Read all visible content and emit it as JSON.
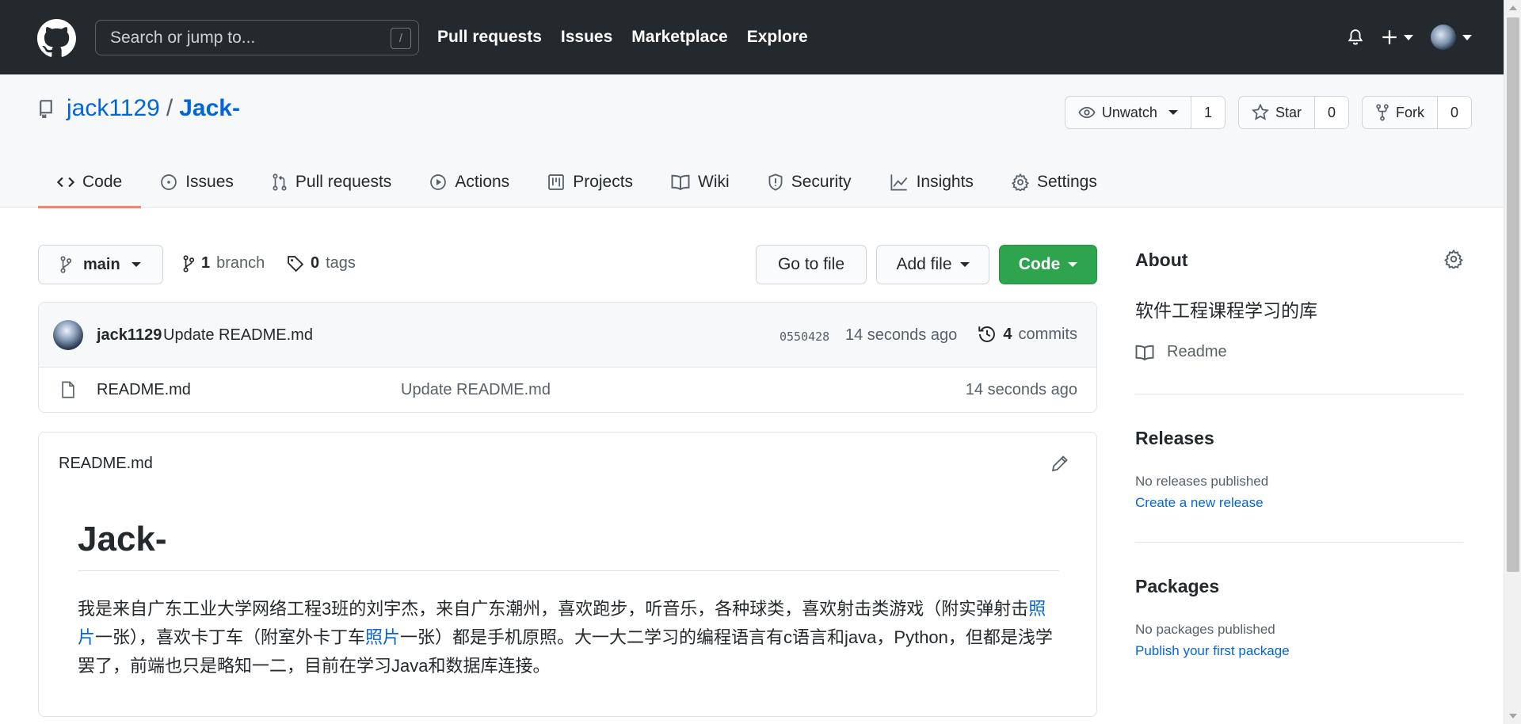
{
  "header": {
    "search_placeholder": "Search or jump to...",
    "search_shortcut": "/",
    "nav": [
      "Pull requests",
      "Issues",
      "Marketplace",
      "Explore"
    ]
  },
  "repo": {
    "owner": "jack1129",
    "separator": "/",
    "name": "Jack-",
    "watch_label": "Unwatch",
    "watch_count": "1",
    "star_label": "Star",
    "star_count": "0",
    "fork_label": "Fork",
    "fork_count": "0"
  },
  "tabs": [
    {
      "label": "Code",
      "icon": "code-icon",
      "active": true
    },
    {
      "label": "Issues",
      "icon": "issue-icon"
    },
    {
      "label": "Pull requests",
      "icon": "pull-request-icon"
    },
    {
      "label": "Actions",
      "icon": "play-icon"
    },
    {
      "label": "Projects",
      "icon": "project-icon"
    },
    {
      "label": "Wiki",
      "icon": "book-icon"
    },
    {
      "label": "Security",
      "icon": "shield-icon"
    },
    {
      "label": "Insights",
      "icon": "graph-icon"
    },
    {
      "label": "Settings",
      "icon": "gear-icon"
    }
  ],
  "branchbar": {
    "branch": "main",
    "branch_count": "1",
    "branch_label": "branch",
    "tag_count": "0",
    "tag_label": "tags",
    "go_to_file": "Go to file",
    "add_file": "Add file",
    "code": "Code"
  },
  "commit": {
    "author": "jack1129",
    "message": "Update README.md",
    "sha": "0550428",
    "time": "14 seconds ago",
    "count": "4",
    "count_label": "commits"
  },
  "files": [
    {
      "name": "README.md",
      "message": "Update README.md",
      "time": "14 seconds ago"
    }
  ],
  "readme": {
    "filename": "README.md",
    "title": "Jack-",
    "p_part1": "我是来自广东工业大学网络工程3班的刘宇杰，来自广东潮州，喜欢跑步，听音乐，各种球类，喜欢射击类游戏（附实弹射击",
    "link1": "照片",
    "p_part2": "一张），喜欢卡丁车（附室外卡丁车",
    "link2": "照片",
    "p_part3": "一张）都是手机原照。大一大二学习的编程语言有c语言和java，Python，但都是浅学罢了，前端也只是略知一二，目前在学习Java和数据库连接。"
  },
  "sidebar": {
    "about_title": "About",
    "description": "软件工程课程学习的库",
    "readme_label": "Readme",
    "releases_title": "Releases",
    "releases_none": "No releases published",
    "releases_link": "Create a new release",
    "packages_title": "Packages",
    "packages_none": "No packages published",
    "packages_link": "Publish your first package"
  },
  "colors": {
    "header_bg": "#24292e",
    "link": "#0366d6",
    "primary_button": "#2ea44f",
    "active_tab_underline": "#f9826c"
  }
}
